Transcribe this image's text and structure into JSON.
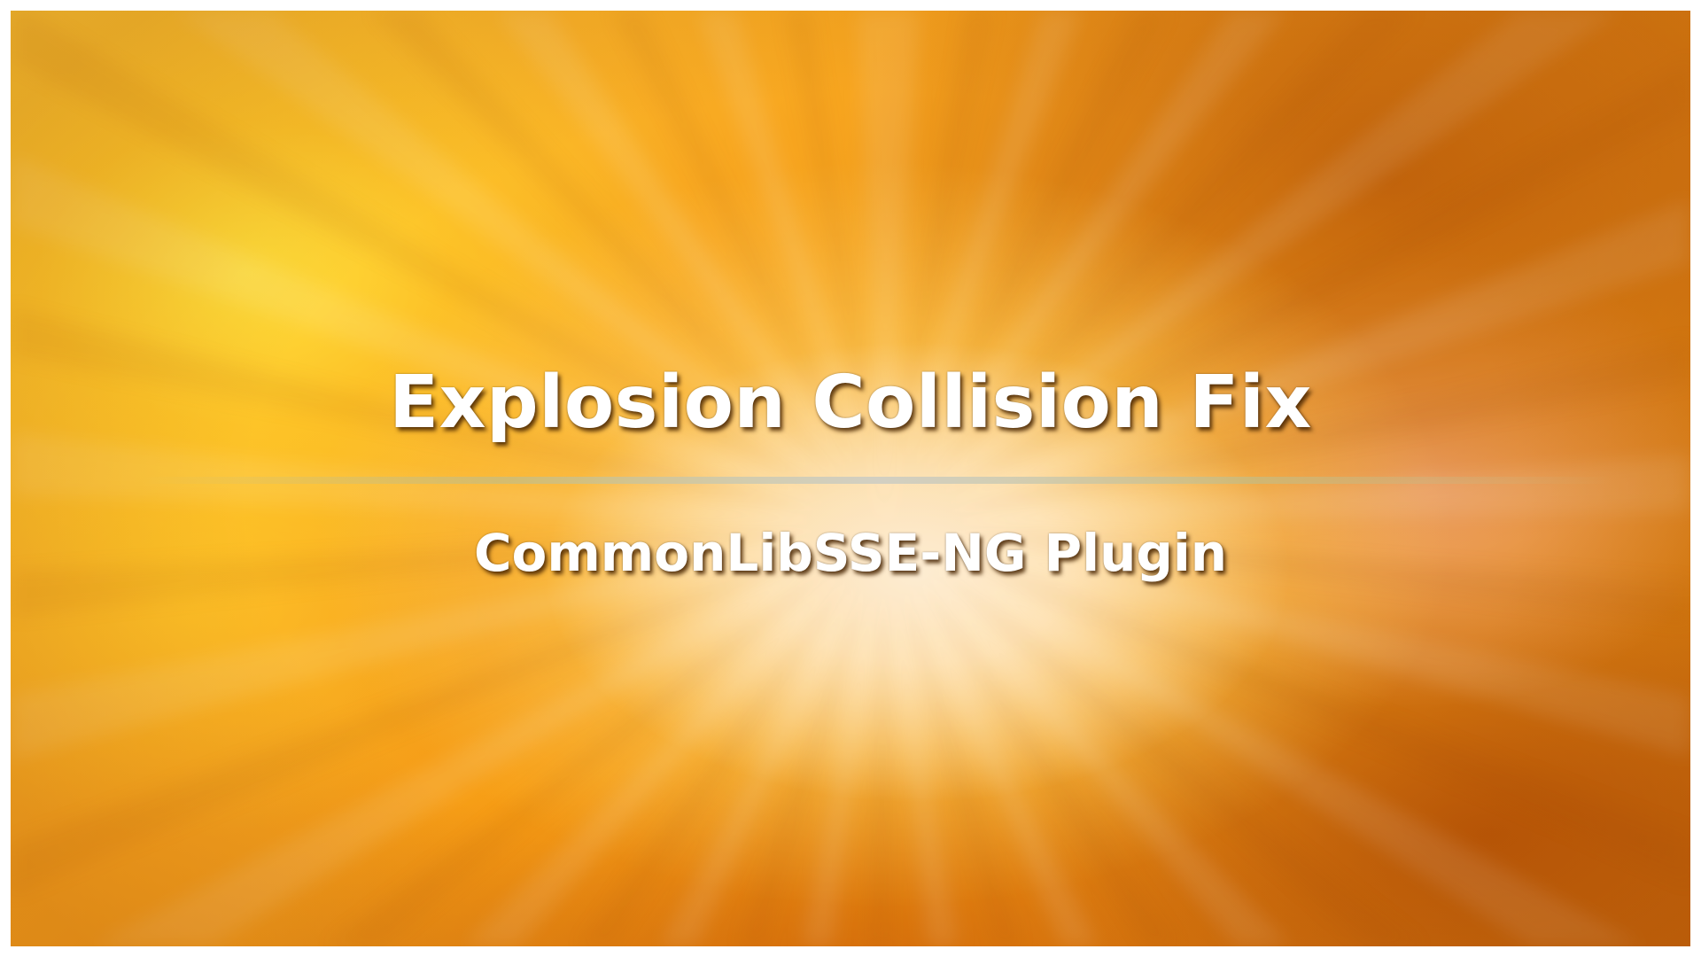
{
  "banner": {
    "title": "Explosion Collision Fix",
    "subtitle": "CommonLibSSE-NG Plugin"
  },
  "colors": {
    "background_primary": "#f7a51f",
    "background_highlight": "#ffe8c3",
    "text": "#ffffff",
    "divider": "#cdcdc3"
  }
}
